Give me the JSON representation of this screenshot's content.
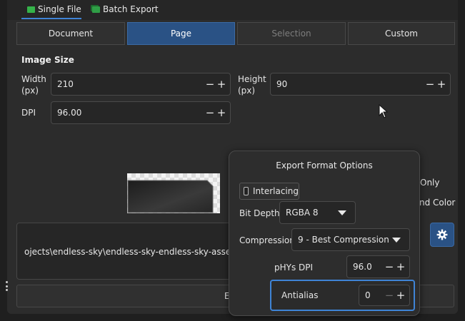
{
  "tabs": [
    {
      "label": "Single File",
      "icon": "image-icon",
      "active": true
    },
    {
      "label": "Batch Export",
      "icon": "batch-images-icon",
      "active": false
    }
  ],
  "segments": [
    {
      "label": "Document",
      "state": "normal"
    },
    {
      "label": "Page",
      "state": "active"
    },
    {
      "label": "Selection",
      "state": "disabled"
    },
    {
      "label": "Custom",
      "state": "normal"
    }
  ],
  "image_size": {
    "title": "Image Size",
    "width_label": "Width\n(px)",
    "width_value": "210",
    "height_label": "Height\n(px)",
    "height_value": "90",
    "dpi_label": "DPI",
    "dpi_value": "96.00"
  },
  "right_options_partial": {
    "only_text": "Only",
    "color_text": "nd Color"
  },
  "export_path": "ojects\\endless-sky\\endless-sky-endless-sky-assets\\ui\\o",
  "export_button_partial": "E",
  "popup": {
    "title": "Export Format Options",
    "interlacing_label": "Interlacing",
    "interlacing_checked": false,
    "bit_depth_label": "Bit Depth",
    "bit_depth_value": "RGBA 8",
    "compression_label": "Compression",
    "compression_value": "9 - Best Compression",
    "phys_dpi_label": "pHYs DPI",
    "phys_dpi_value": "96.0",
    "antialias_label": "Antialias",
    "antialias_value": "0"
  },
  "colors": {
    "accent": "#3f84d6",
    "active_segment": "#2a5285",
    "panel": "#2c2c2c",
    "field": "#262626"
  }
}
